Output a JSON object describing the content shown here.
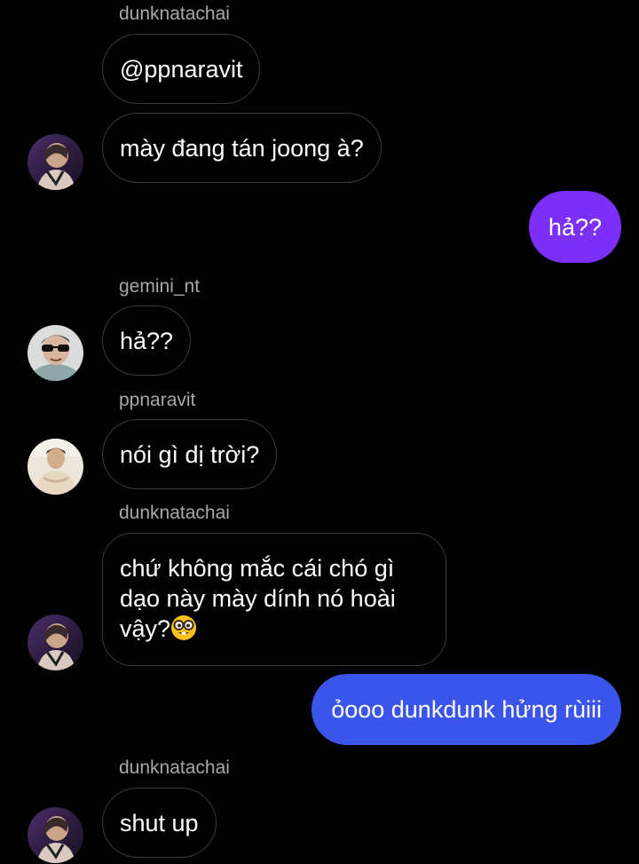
{
  "messages": [
    {
      "type": "username",
      "text": "dunknatachai"
    },
    {
      "type": "incoming",
      "text": "@ppnaravit"
    },
    {
      "type": "incoming",
      "text": "mày đang tán joong à?"
    },
    {
      "type": "outgoing",
      "text": "hả??",
      "color": "#7b2ff7"
    },
    {
      "type": "username",
      "text": "gemini_nt"
    },
    {
      "type": "incoming",
      "text": "hả??"
    },
    {
      "type": "username",
      "text": "ppnaravit"
    },
    {
      "type": "incoming",
      "text": "nói gì dị trời?"
    },
    {
      "type": "username",
      "text": "dunknatachai"
    },
    {
      "type": "incoming",
      "lines": [
        "chứ không mắc cái chó gì",
        "dạo này mày dính nó hoài",
        "vậy?"
      ],
      "trailing_emoji": "nerd-face-emoji"
    },
    {
      "type": "outgoing",
      "text": "ỏooo dunkdunk hửng rùiii",
      "color": "#3b55ea"
    },
    {
      "type": "username",
      "text": "dunknatachai"
    },
    {
      "type": "incoming",
      "text": "shut up"
    }
  ],
  "avatars": [
    "dunknatachai-avatar",
    "gemini_nt-avatar",
    "ppnaravit-avatar",
    "dunknatachai-avatar",
    "dunknatachai-avatar"
  ],
  "colors": {
    "background": "#000000",
    "incoming_border": "#3a3a3a",
    "username_text": "#a8a8a8",
    "outgoing_purple": "#7b2ff7",
    "outgoing_blue": "#3b55ea"
  }
}
